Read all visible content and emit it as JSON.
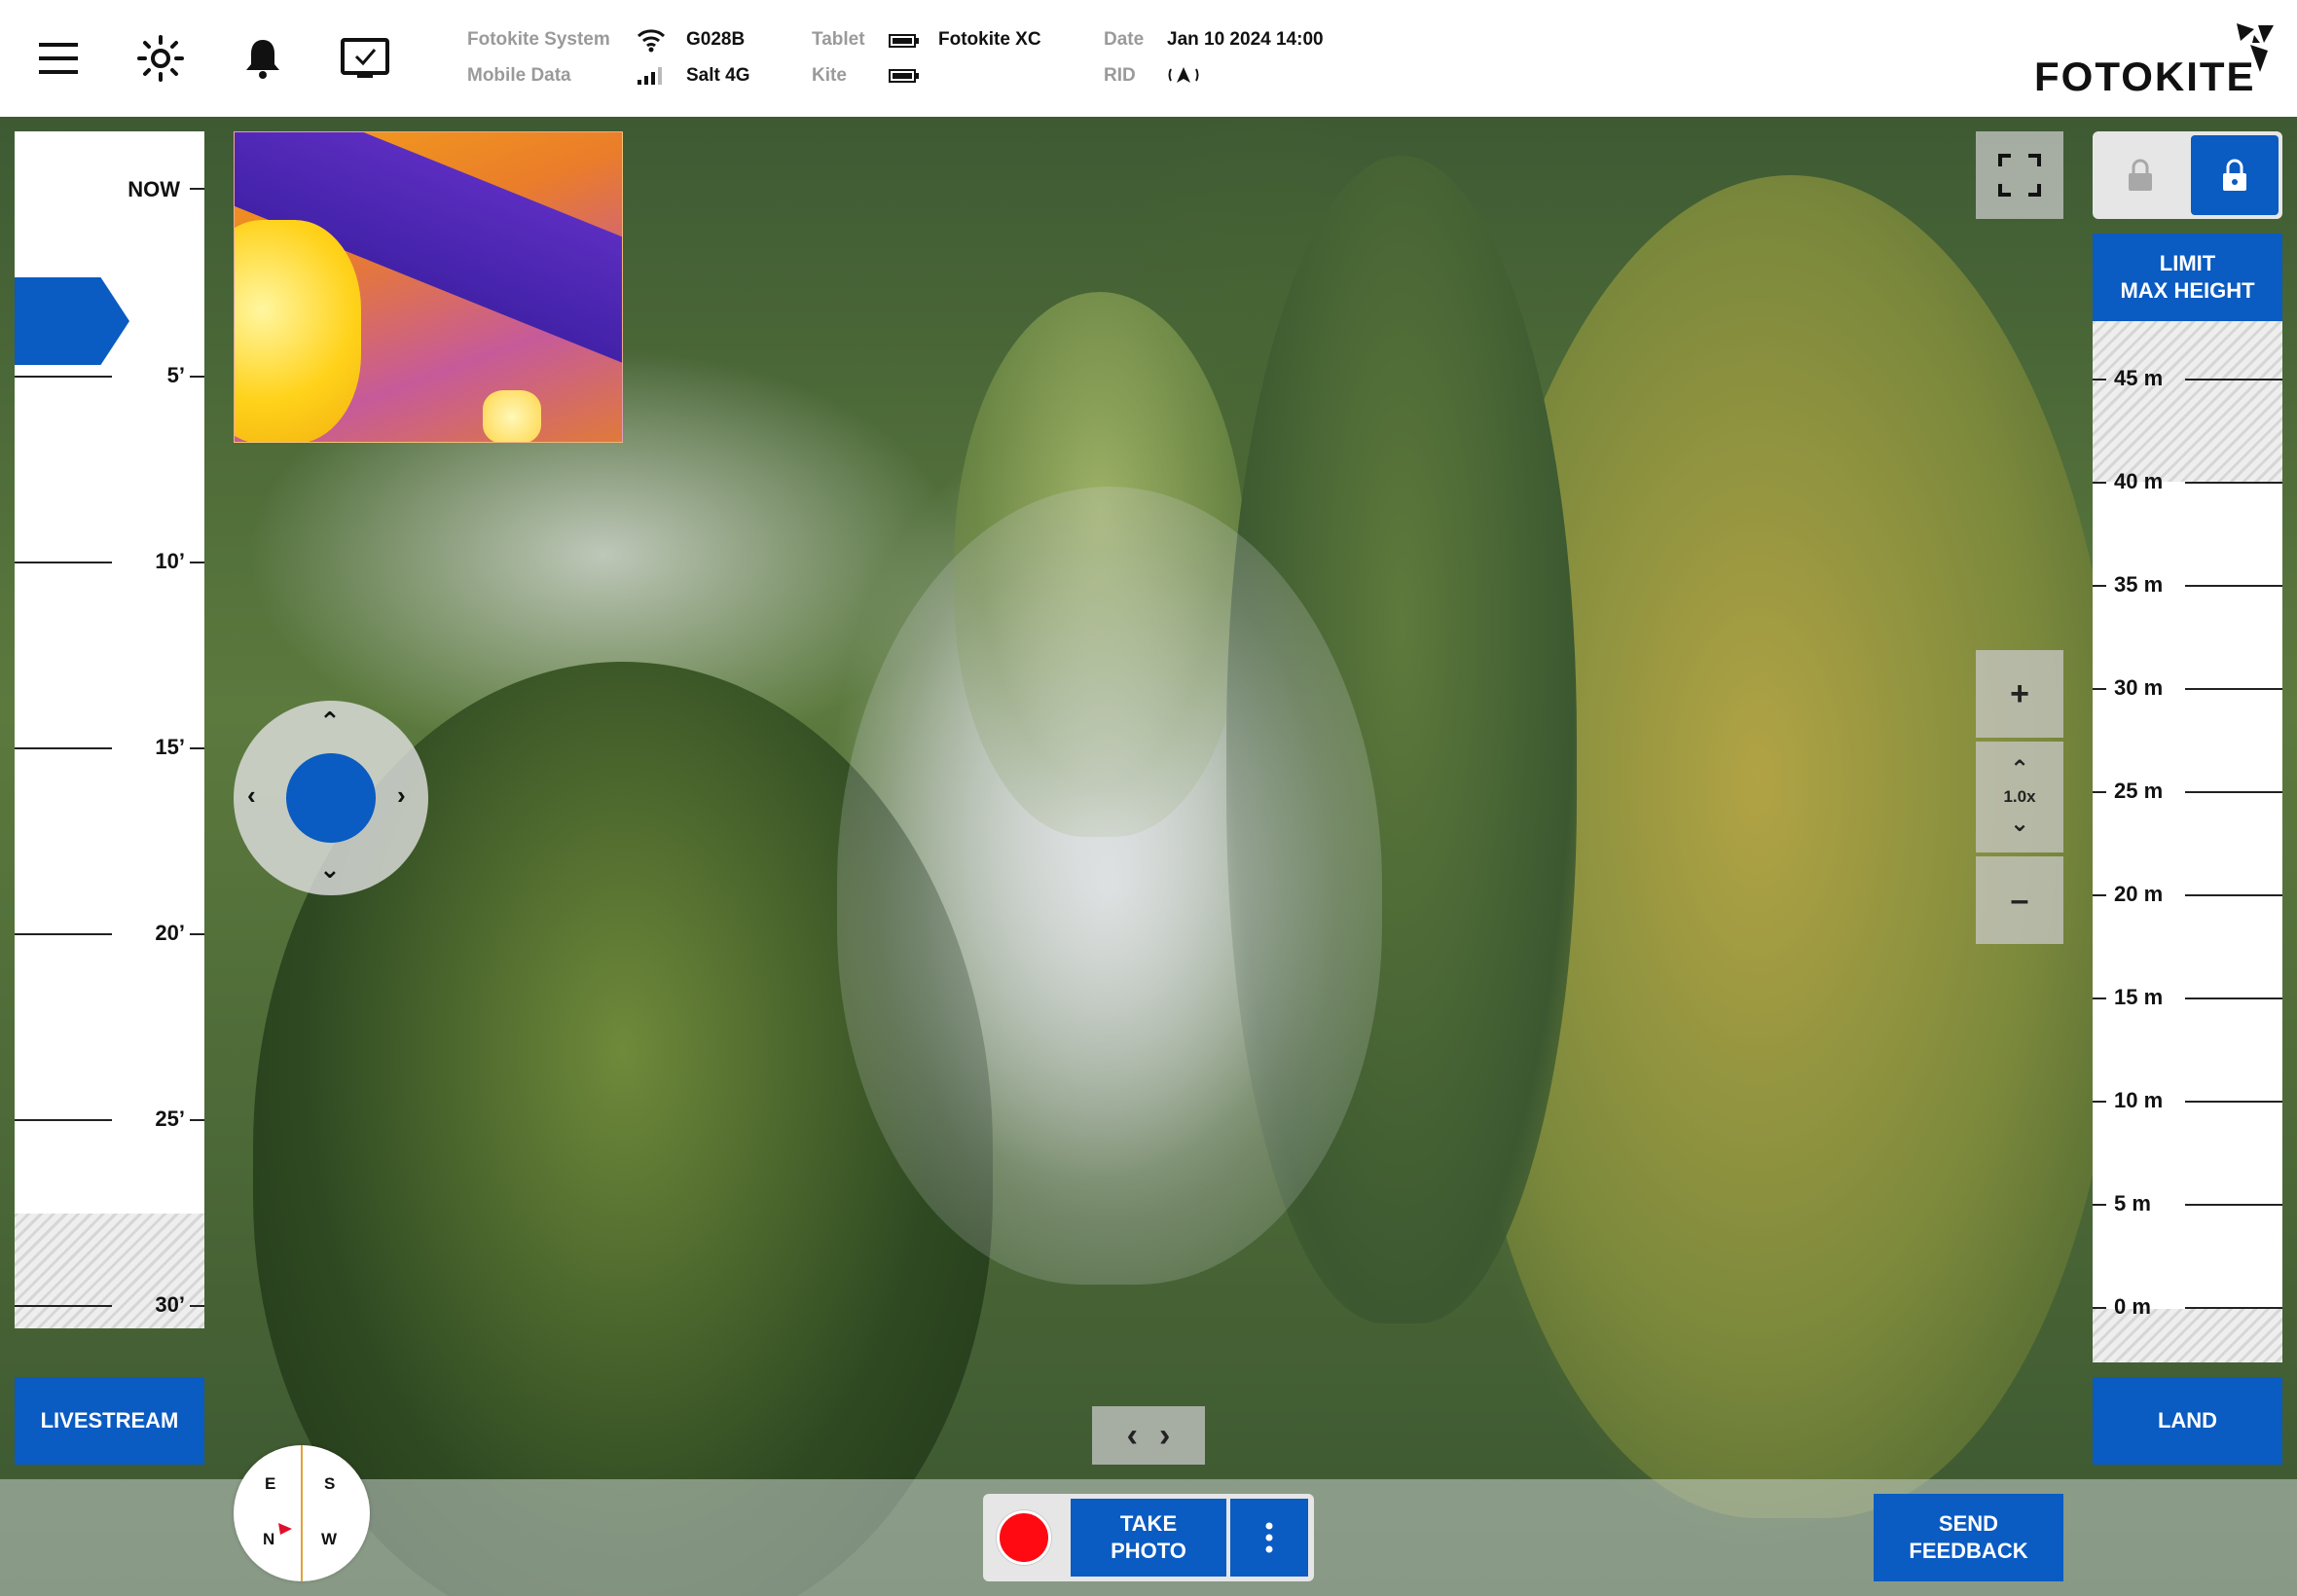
{
  "topbar": {
    "status": {
      "system_label": "Fotokite System",
      "system_value": "G028B",
      "mobile_label": "Mobile Data",
      "mobile_value": "Salt 4G",
      "tablet_label": "Tablet",
      "tablet_value": "Fotokite XC",
      "kite_label": "Kite",
      "date_label": "Date",
      "date_value": "Jan 10 2024 14:00",
      "rid_label": "RID"
    },
    "brand": "FOTOKITE"
  },
  "left_ruler": {
    "now_label": "NOW",
    "labels": [
      "5’",
      "10’",
      "15’",
      "20’",
      "25’",
      "30’"
    ]
  },
  "right_ruler": {
    "limit_button": "LIMIT\nMAX HEIGHT",
    "labels": [
      "45 m",
      "40 m",
      "35 m",
      "30 m",
      "25 m",
      "20 m",
      "15 m",
      "10 m",
      "5 m",
      "0 m"
    ]
  },
  "zoom": {
    "plus": "+",
    "level": "1.0x",
    "minus": "–"
  },
  "compass": {
    "e": "E",
    "s": "S",
    "n": "N",
    "w": "W"
  },
  "buttons": {
    "livestream": "LIVESTREAM",
    "land": "LAND",
    "take_photo": "TAKE\nPHOTO",
    "send_feedback": "SEND\nFEEDBACK"
  },
  "colors": {
    "accent": "#0a5bc2",
    "record": "#ff0a12"
  }
}
